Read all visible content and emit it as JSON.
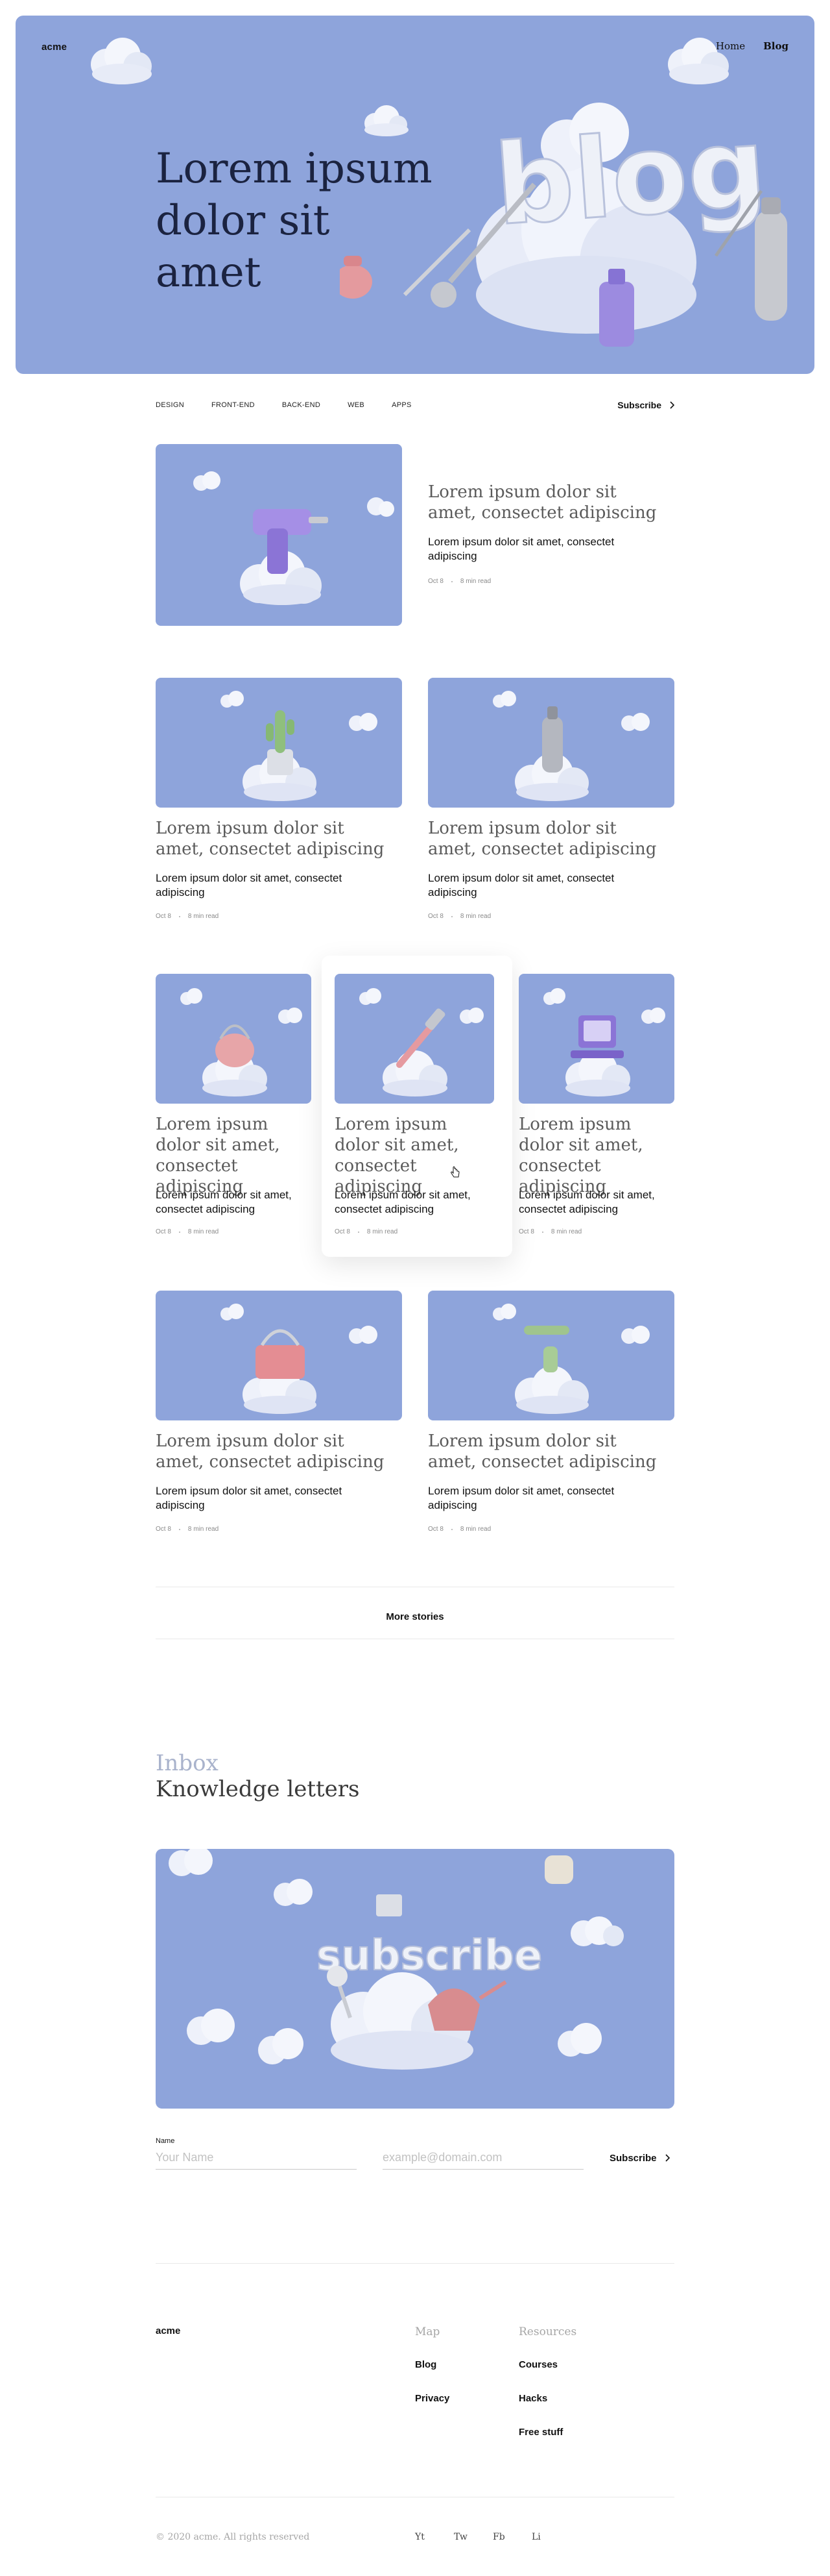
{
  "brand": {
    "logo": "acme"
  },
  "nav": {
    "home": "Home",
    "blog": "Blog"
  },
  "hero": {
    "title": "Lorem ipsum dolor sit amet",
    "art_word": "blog"
  },
  "categories": [
    "DESIGN",
    "FRONT-END",
    "BACK-END",
    "WEB",
    "APPS"
  ],
  "subscribe_link": "Subscribe",
  "article": {
    "title": "Lorem ipsum dolor sit amet, consectet  adipiscing",
    "excerpt": "Lorem ipsum dolor sit amet, consectet adipiscing",
    "date": "Oct 8",
    "read": "8 min read"
  },
  "more_stories": "More stories",
  "inbox": {
    "label": "Inbox",
    "title": "Knowledge letters",
    "banner_word": "subscribe",
    "name_label": "Name",
    "name_placeholder": "Your Name",
    "email_placeholder": "example@domain.com",
    "button": "Subscribe"
  },
  "footer": {
    "logo": "acme",
    "col1_head": "Map",
    "col1_links": [
      "Blog",
      "Privacy"
    ],
    "col2_head": "Resources",
    "col2_links": [
      "Courses",
      "Hacks",
      "Free stuff"
    ],
    "copyright": "© 2020 acme. All rights reserved",
    "social": [
      "Yt",
      "Tw",
      "Fb",
      "Li"
    ]
  },
  "colors": {
    "hero_blue": "#8ea4db",
    "cloud": "#eef1fa",
    "text": "#111111",
    "muted": "#8a8a8a"
  }
}
